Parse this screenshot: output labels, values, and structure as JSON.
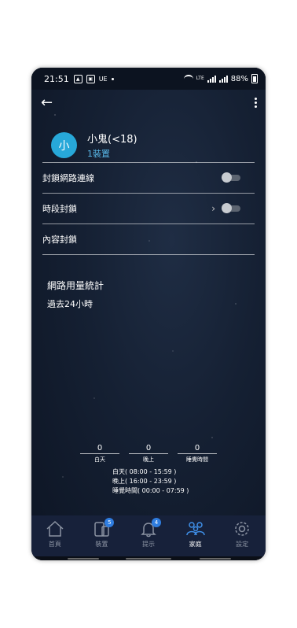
{
  "status_bar": {
    "time": "21:51",
    "left_extra": "UE",
    "lte_label": "Vo)\nLTE1",
    "battery": "88%"
  },
  "profile": {
    "avatar_initial": "小",
    "name": "小鬼(<18)",
    "devices": "1裝置"
  },
  "settings": {
    "block_network": {
      "label": "封鎖網路連線",
      "toggle_on": false
    },
    "schedule_block": {
      "label": "時段封鎖",
      "toggle_on": false
    },
    "content_block": {
      "label": "內容封鎖"
    }
  },
  "stats": {
    "title": "網路用量統計",
    "period": "過去24小時",
    "buckets": [
      {
        "value": "0",
        "label": "白天"
      },
      {
        "value": "0",
        "label": "晚上"
      },
      {
        "value": "0",
        "label": "睡覺時間"
      }
    ],
    "legend": [
      "白天( 08:00 - 15:59 )",
      "晚上( 16:00 - 23:59 )",
      "睡覺時間( 00:00 - 07:59 )"
    ]
  },
  "tabs": [
    {
      "label": "首頁",
      "icon": "home-icon"
    },
    {
      "label": "裝置",
      "icon": "devices-icon",
      "badge": "5"
    },
    {
      "label": "提示",
      "icon": "bell-icon",
      "badge": "4"
    },
    {
      "label": "家庭",
      "icon": "family-icon",
      "active": true
    },
    {
      "label": "設定",
      "icon": "gear-icon"
    }
  ],
  "colors": {
    "accent": "#27a8d9",
    "badge": "#2f7de0",
    "background": "#152033"
  }
}
